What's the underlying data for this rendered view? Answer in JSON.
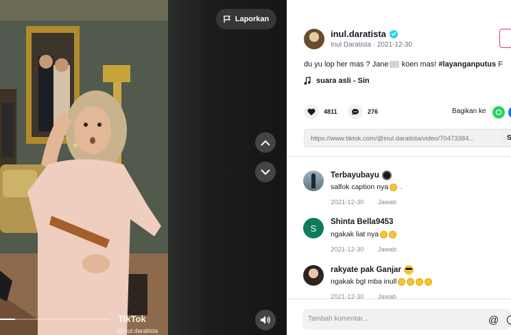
{
  "video": {
    "report_label": "Laporkan",
    "watermark_brand": "TikTok",
    "watermark_user": "@inul.daratista",
    "progress": 0.14,
    "icons": {
      "report": "flag-icon",
      "prev": "chevron-up-icon",
      "next": "chevron-down-icon",
      "volume": "speaker-icon"
    }
  },
  "author": {
    "username": "inul.daratista",
    "display_name": "Inul Daratista",
    "date": "2021-12-30",
    "separator": "·"
  },
  "post": {
    "caption_text": "du yu lop her mas ? Jane",
    "caption_text2": " koen mas! ",
    "caption_hashtag": "#layanganputus",
    "caption_tail": " F",
    "sound": "suara asli - Sin"
  },
  "actions": {
    "likes": "4811",
    "comments": "276",
    "share_label": "Bagikan ke"
  },
  "share_link": {
    "url": "https://www.tiktok.com/@inul.daratista/video/70473384...",
    "copy_label": "Sa"
  },
  "comments": [
    {
      "name": "Terbayubayu",
      "text": "salfok caption nya",
      "date": "2021-12-30",
      "reply": "Jawab"
    },
    {
      "name": "Shinta Bella9453",
      "text": "ngakak liat nya",
      "date": "2021-12-30",
      "reply": "Jawab",
      "initial": "S"
    },
    {
      "name": "rakyate pak Ganjar",
      "text": "ngakak bgt mba inull",
      "date": "2021-12-30",
      "reply": "Jawab"
    }
  ],
  "comment_input": {
    "placeholder": "Tambah komentar...",
    "mention_symbol": "@"
  },
  "colors": {
    "accent": "#fe2c55",
    "verified": "#20d5ec",
    "whatsapp": "#25d366",
    "initial_avatar": "#0f7b5c"
  }
}
